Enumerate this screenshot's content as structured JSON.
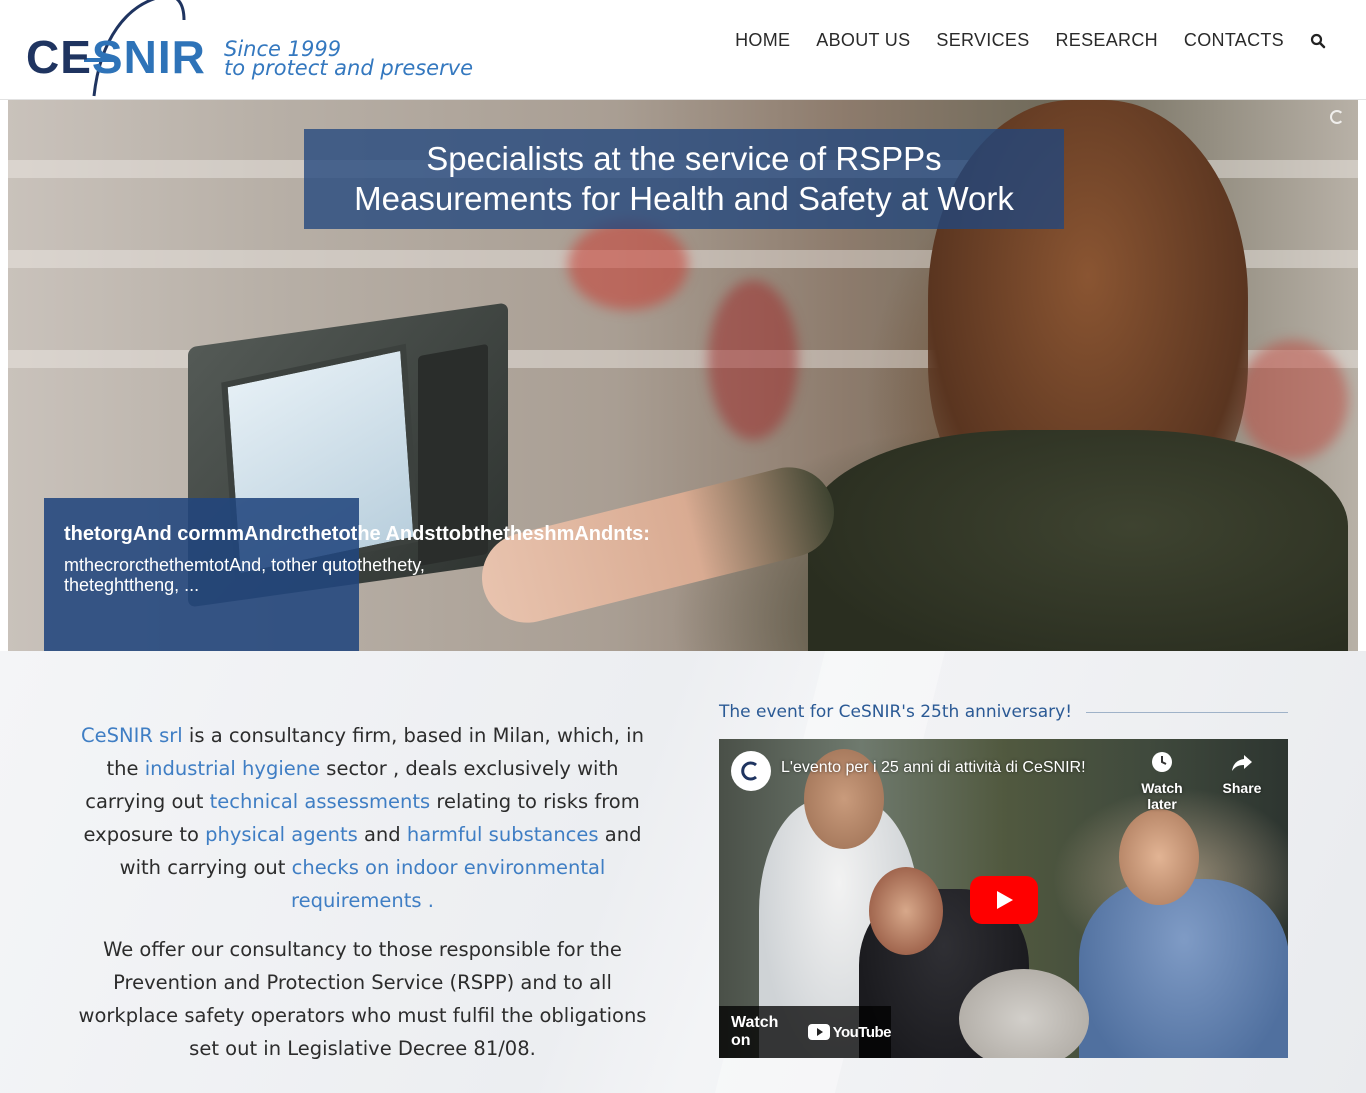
{
  "brand": {
    "logo_text": "CeSNIR",
    "tagline_line1": "Since 1999",
    "tagline_line2": "to protect and preserve",
    "color_dark": "#1f3460",
    "color_light": "#2e73b8"
  },
  "nav": {
    "items": [
      {
        "label": "HOME"
      },
      {
        "label": "ABOUT US"
      },
      {
        "label": "SERVICES"
      },
      {
        "label": "RESEARCH"
      },
      {
        "label": "CONTACTS"
      }
    ],
    "search_icon": "search-icon"
  },
  "hero": {
    "title_line1": "Specialists at the service of RSPPs",
    "title_line2": "Measurements for Health and Safety at Work",
    "caption_title": "thetorgAnd cormmAndrcthetothe AndsttobthetheshmAndnts:",
    "caption_text": "mthecrorcthethemtotAnd, tother qutothethety, theteghttheng, ...",
    "overlay_color": "#21467d"
  },
  "intro": {
    "p1": {
      "s1": "CeSNIR srl",
      "s2": " is a consultancy firm, based in Milan, which, in the ",
      "s3": "industrial hygiene",
      "s4": " sector , deals exclusively with carrying out ",
      "s5": "technical assessments",
      "s6": " relating to risks from exposure to ",
      "s7": "physical agents",
      "s8": " and ",
      "s9": "harmful substances",
      "s10": " and with carrying out ",
      "s11": "checks on indoor environmental requirements .",
      "s12": ""
    },
    "p2": "We offer our consultancy to those responsible for the Prevention and Protection Service (RSPP) and to all workplace safety operators who must fulfil the obligations set out in Legislative Decree 81/08.",
    "highlight_color": "#3f7ec4"
  },
  "event": {
    "heading": "The event for CeSNIR's 25th anniversary!",
    "video": {
      "title": "L'evento per i 25 anni di attività di CeSNIR!",
      "watch_later": "Watch later",
      "share": "Share",
      "watch_on": "Watch on",
      "platform": "YouTube"
    }
  }
}
